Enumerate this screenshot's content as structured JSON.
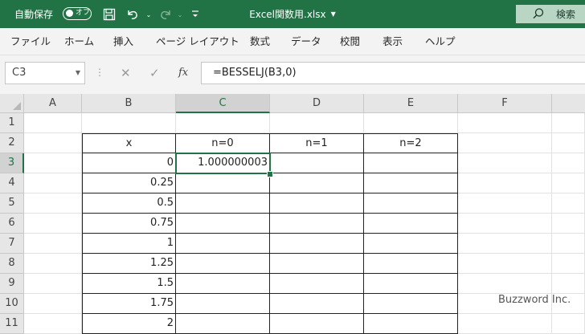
{
  "titlebar": {
    "autosave_label": "自動保存",
    "autosave_state": "オフ",
    "document_title": "Excel関数用.xlsx",
    "search_label": "検索"
  },
  "menu": {
    "items": [
      "ファイル",
      "ホーム",
      "挿入",
      "ページ レイアウト",
      "数式",
      "データ",
      "校閲",
      "表示",
      "ヘルプ"
    ]
  },
  "formula_bar": {
    "name_box": "C3",
    "fx_label": "fx",
    "formula": "=BESSELJ(B3,0)"
  },
  "grid": {
    "columns": [
      "A",
      "B",
      "C",
      "D",
      "E",
      "F"
    ],
    "selected_column": "C",
    "rows": [
      "1",
      "2",
      "3",
      "4",
      "5",
      "6",
      "7",
      "8",
      "9",
      "10",
      "11"
    ],
    "selected_row": "3",
    "headers": [
      "x",
      "n=0",
      "n=1",
      "n=2"
    ],
    "x_values": [
      "0",
      "0.25",
      "0.5",
      "0.75",
      "1",
      "1.25",
      "1.5",
      "1.75",
      "2"
    ],
    "c3_value": "1.000000003"
  },
  "watermark": "Buzzword Inc."
}
